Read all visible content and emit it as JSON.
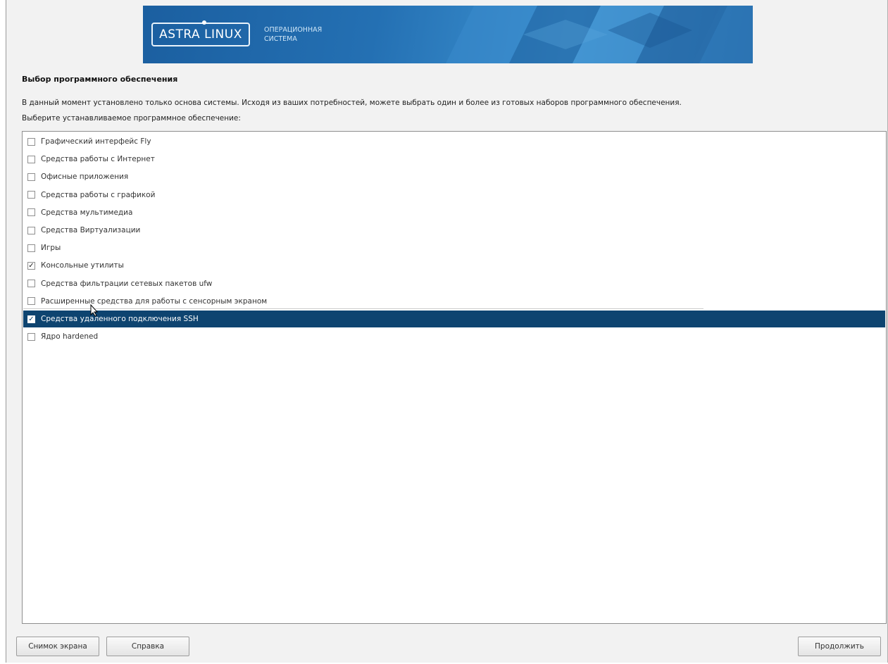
{
  "banner": {
    "logo_text": "ASTRA LINUX",
    "subtitle_line1": "ОПЕРАЦИОННАЯ",
    "subtitle_line2": "СИСТЕМА"
  },
  "page_title": "Выбор программного обеспечения",
  "description": "В данный момент установлено только основа системы. Исходя из ваших потребностей, можете выбрать один и более из готовых наборов программного обеспечения.",
  "prompt": "Выберите устанавливаемое программное обеспечение:",
  "software": [
    {
      "label": "Графический интерфейс Fly",
      "checked": false
    },
    {
      "label": "Средства работы с Интернет",
      "checked": false
    },
    {
      "label": "Офисные приложения",
      "checked": false
    },
    {
      "label": "Средства работы с графикой",
      "checked": false
    },
    {
      "label": "Средства мультимедиа",
      "checked": false
    },
    {
      "label": "Средства Виртуализации",
      "checked": false
    },
    {
      "label": "Игры",
      "checked": false
    },
    {
      "label": "Консольные утилиты",
      "checked": true
    },
    {
      "label": "Средства фильтрации сетевых пакетов ufw",
      "checked": false
    },
    {
      "label": "Расширенные средства для работы с сенсорным экраном",
      "checked": false
    },
    {
      "label": "Средства удаленного подключения SSH",
      "checked": true,
      "selected": true
    },
    {
      "label": "Ядро hardened",
      "checked": false
    }
  ],
  "check_glyph": "✓",
  "buttons": {
    "screenshot": "Снимок экрана",
    "help": "Справка",
    "continue": "Продолжить"
  },
  "colors": {
    "selection": "#0e4470",
    "banner": "#2470b3"
  }
}
